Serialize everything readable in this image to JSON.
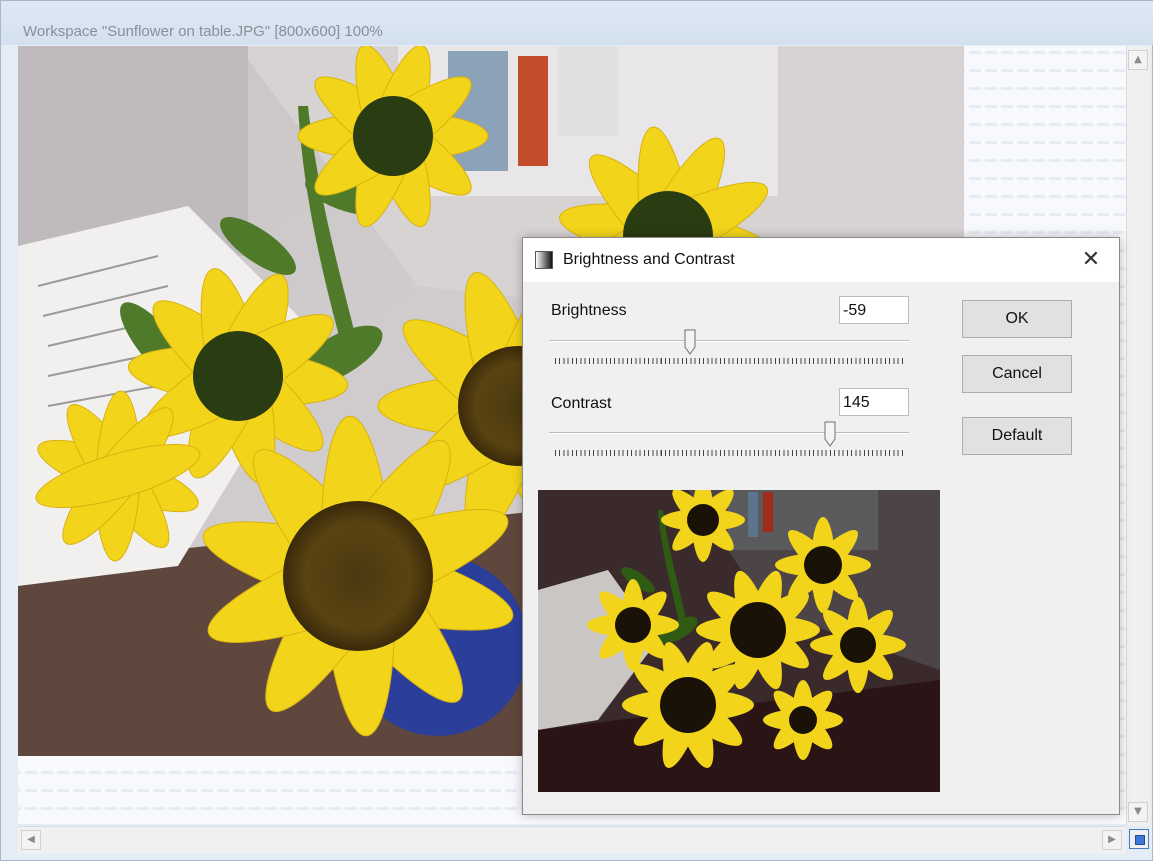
{
  "workspace": {
    "title": "Workspace \"Sunflower on table.JPG\"  [800x600] 100%"
  },
  "scrollbars": {
    "up_icon": "scroll-up-arrow",
    "down_icon": "scroll-down-arrow",
    "left_icon": "scroll-left-arrow",
    "right_icon": "scroll-right-arrow"
  },
  "dialog": {
    "title": "Brightness and Contrast",
    "close_glyph": "✕",
    "brightness": {
      "label": "Brightness",
      "value": "-59",
      "min": -255,
      "max": 255
    },
    "contrast": {
      "label": "Contrast",
      "value": "145",
      "min": -255,
      "max": 255
    },
    "buttons": {
      "ok": "OK",
      "cancel": "Cancel",
      "default": "Default"
    }
  },
  "colors": {
    "petal": "#f2d41a",
    "accent": "#3a78d6"
  }
}
